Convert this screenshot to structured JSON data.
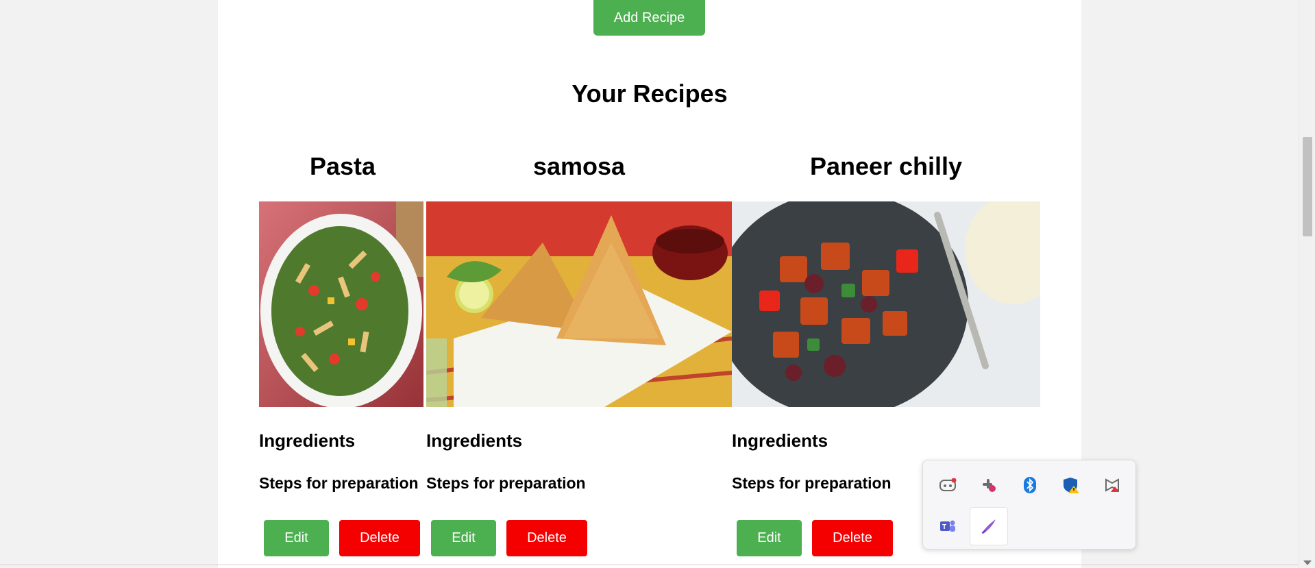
{
  "toolbar": {
    "add_label": "Add Recipe"
  },
  "section": {
    "title": "Your Recipes"
  },
  "recipes": [
    {
      "name": "Pasta",
      "ingredients_label": "Ingredients",
      "steps_label": "Steps for preparation",
      "edit_label": "Edit",
      "delete_label": "Delete"
    },
    {
      "name": "samosa",
      "ingredients_label": "Ingredients",
      "steps_label": "Steps for preparation",
      "edit_label": "Edit",
      "delete_label": "Delete"
    },
    {
      "name": "Paneer chilly",
      "ingredients_label": "Ingredients",
      "steps_label": "Steps for preparation",
      "edit_label": "Edit",
      "delete_label": "Delete"
    }
  ],
  "tray": {
    "icons": [
      "discord-icon",
      "slack-icon",
      "bluetooth-icon",
      "windows-security-icon",
      "mcafee-icon",
      "teams-icon",
      "pen-icon"
    ]
  },
  "colors": {
    "primary": "#4caf50",
    "danger": "#f40000"
  }
}
